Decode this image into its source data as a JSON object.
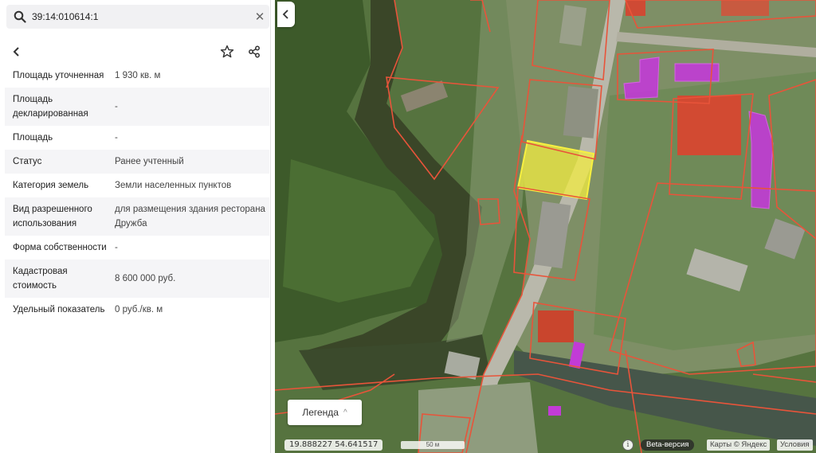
{
  "search": {
    "value": "39:14:010614:1"
  },
  "properties": [
    {
      "key": "Площадь уточненная",
      "value": "1 930 кв. м"
    },
    {
      "key": "Площадь декларированная",
      "value": "-"
    },
    {
      "key": "Площадь",
      "value": "-"
    },
    {
      "key": "Статус",
      "value": "Ранее учтенный"
    },
    {
      "key": "Категория земель",
      "value": "Земли населенных пунктов"
    },
    {
      "key": "Вид разрешенного использования",
      "value": "для размещения здания ресторана Дружба"
    },
    {
      "key": "Форма собственности",
      "value": "-"
    },
    {
      "key": "Кадастровая стоимость",
      "value": "8 600 000 руб."
    },
    {
      "key": "Удельный показатель",
      "value": "0 руб./кв. м"
    }
  ],
  "map": {
    "legend_label": "Легенда",
    "coordinates": "19.888227  54.641517",
    "scale_label": "50 м",
    "beta_label": "Beta-версия",
    "copyright": "Карты © Яндекс",
    "terms": "Условия",
    "watermark": "Yandex"
  },
  "colors": {
    "parcel_border": "#e8543a",
    "selected_fill": "#f3ec42",
    "building_highlight": "#c23bd6"
  },
  "icons": {
    "search": "magnifier",
    "clear": "close",
    "back": "chevron-left",
    "favorite": "star-outline",
    "share": "share",
    "collapse": "chevron-left",
    "info": "info"
  }
}
